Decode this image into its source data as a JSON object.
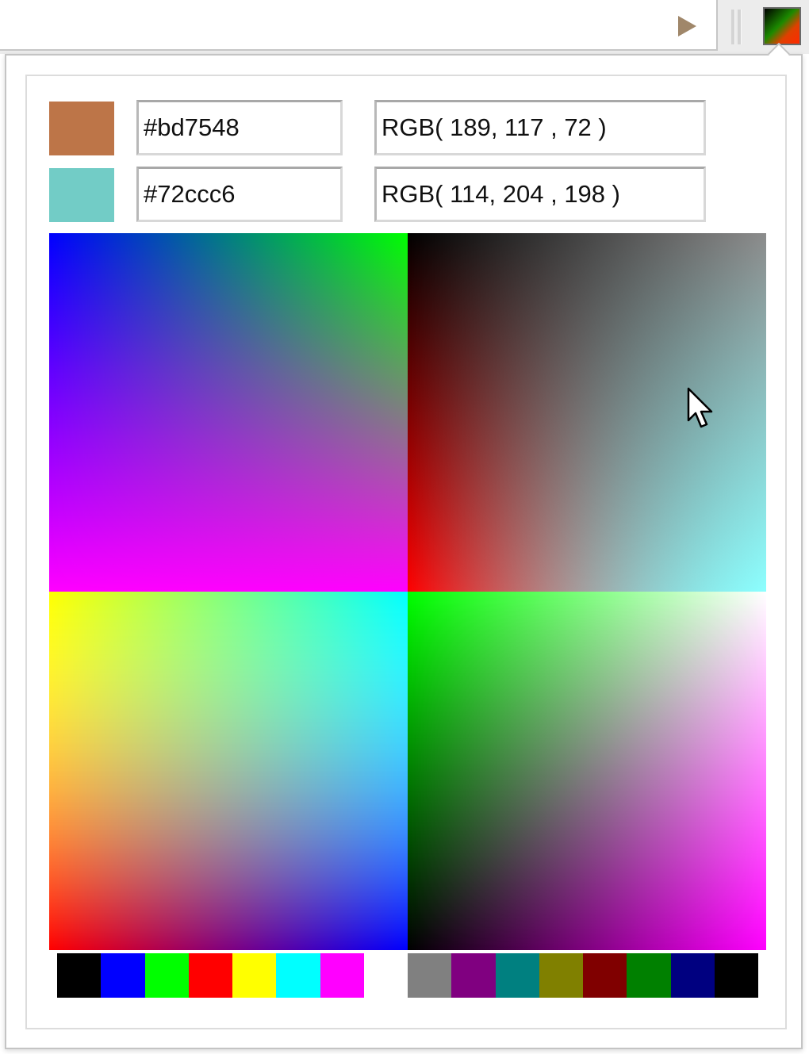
{
  "toolbar": {
    "go_icon": "play-arrow-icon",
    "extension_icon": "color-picker-icon"
  },
  "picker": {
    "primary": {
      "swatch_color": "#bd7548",
      "hex": "#bd7548",
      "rgb": "RGB( 189, 117 , 72 )"
    },
    "secondary": {
      "swatch_color": "#72ccc6",
      "hex": "#72ccc6",
      "rgb": "RGB( 114, 204 , 198 )"
    },
    "palette": [
      "#000000",
      "#0000ff",
      "#00ff00",
      "#ff0000",
      "#ffff00",
      "#00ffff",
      "#ff00ff",
      "#ffffff",
      "#808080",
      "#800080",
      "#008080",
      "#808000",
      "#800000",
      "#008000",
      "#000080",
      "#000000"
    ]
  },
  "colors": {
    "go_arrow": "#a0876a",
    "border": "#c4c4c4"
  }
}
